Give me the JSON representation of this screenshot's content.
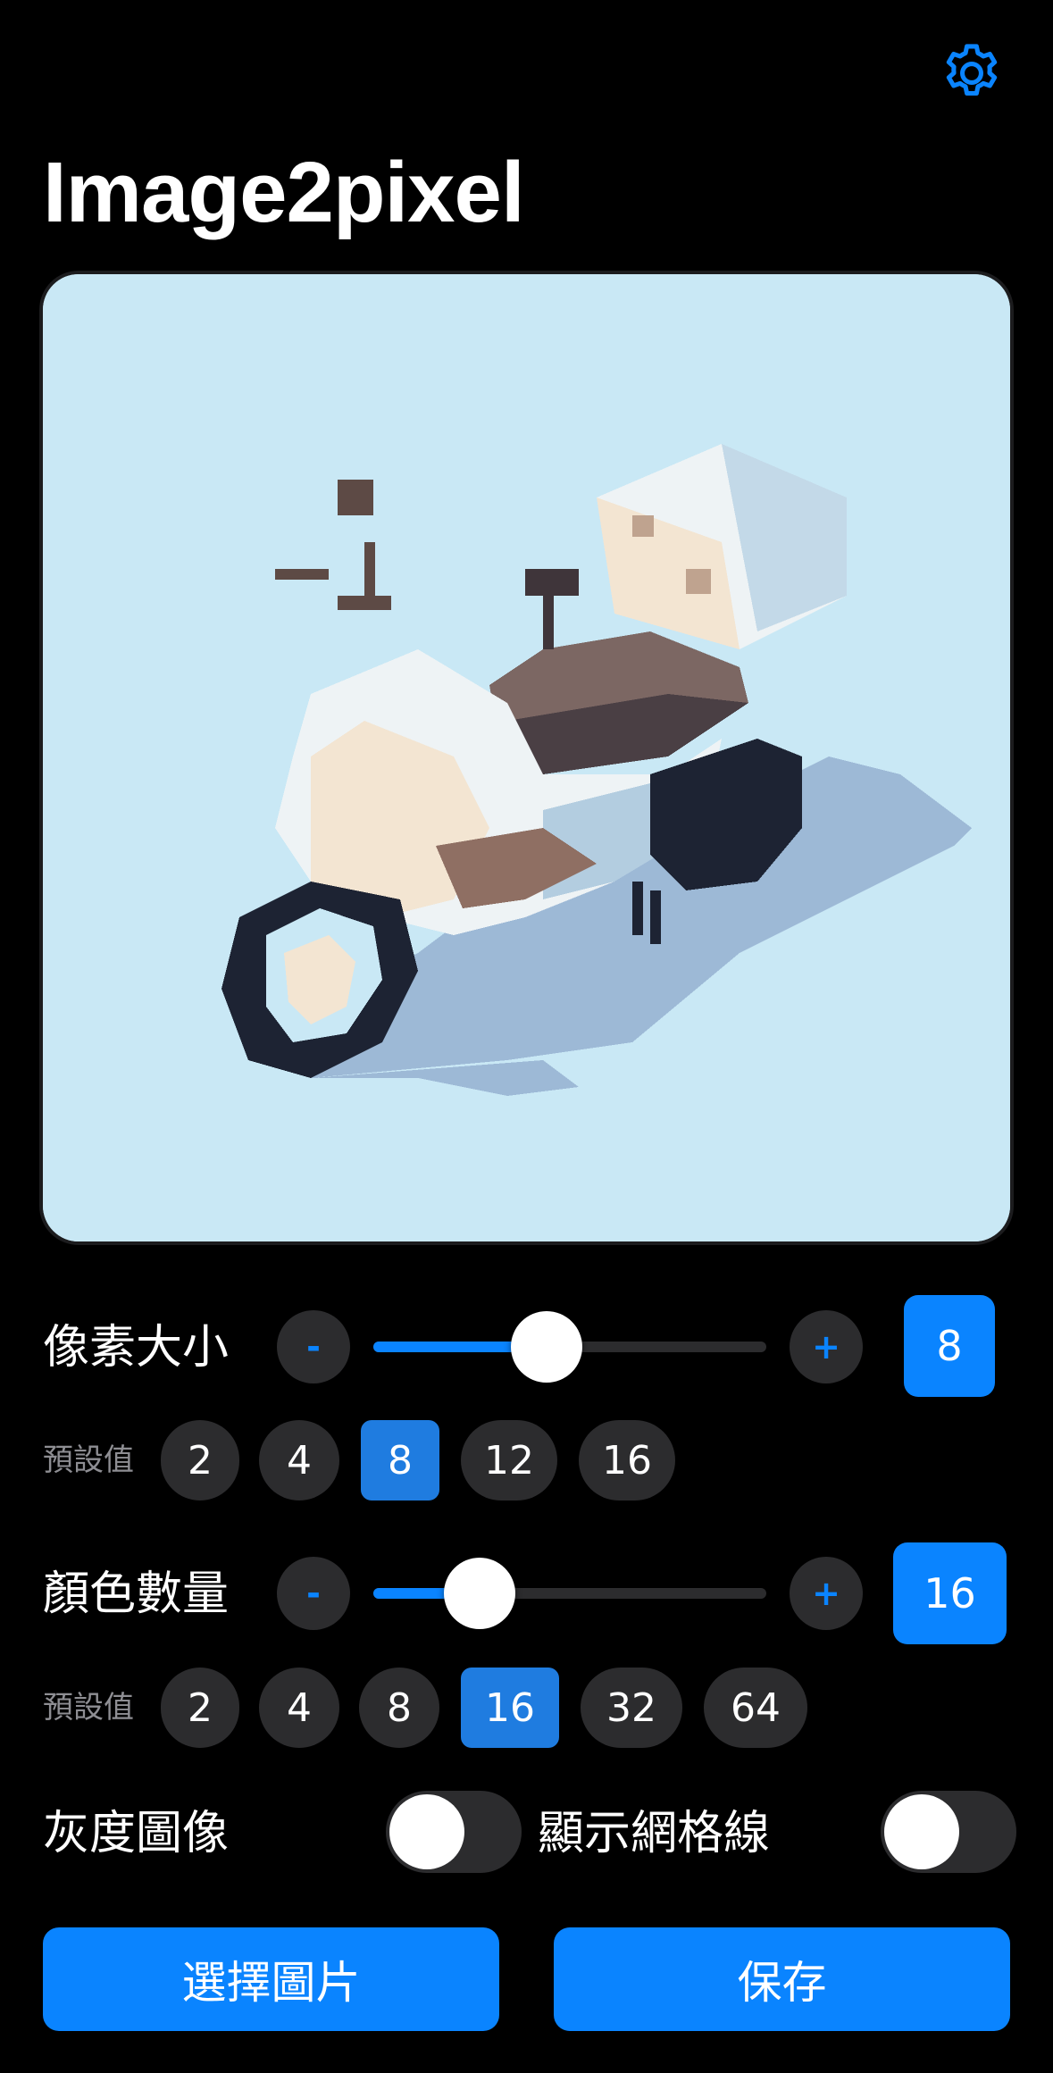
{
  "app": {
    "title": "Image2pixel",
    "settings_icon": "gear-icon",
    "accent_color": "#0a84ff"
  },
  "pixel_size": {
    "label": "像素大小",
    "minus": "-",
    "plus": "+",
    "value": "8",
    "slider_fraction": 0.44,
    "presets_label": "預設值",
    "presets": [
      "2",
      "4",
      "8",
      "12",
      "16"
    ],
    "selected_preset": "8"
  },
  "color_count": {
    "label": "顏色數量",
    "minus": "-",
    "plus": "+",
    "value": "16",
    "slider_fraction": 0.27,
    "presets_label": "預設值",
    "presets": [
      "2",
      "4",
      "8",
      "16",
      "32",
      "64"
    ],
    "selected_preset": "16"
  },
  "toggles": {
    "grayscale_label": "灰度圖像",
    "grayscale_on": false,
    "grid_label": "顯示網格線",
    "grid_on": false
  },
  "actions": {
    "choose_image": "選擇圖片",
    "save": "保存"
  }
}
